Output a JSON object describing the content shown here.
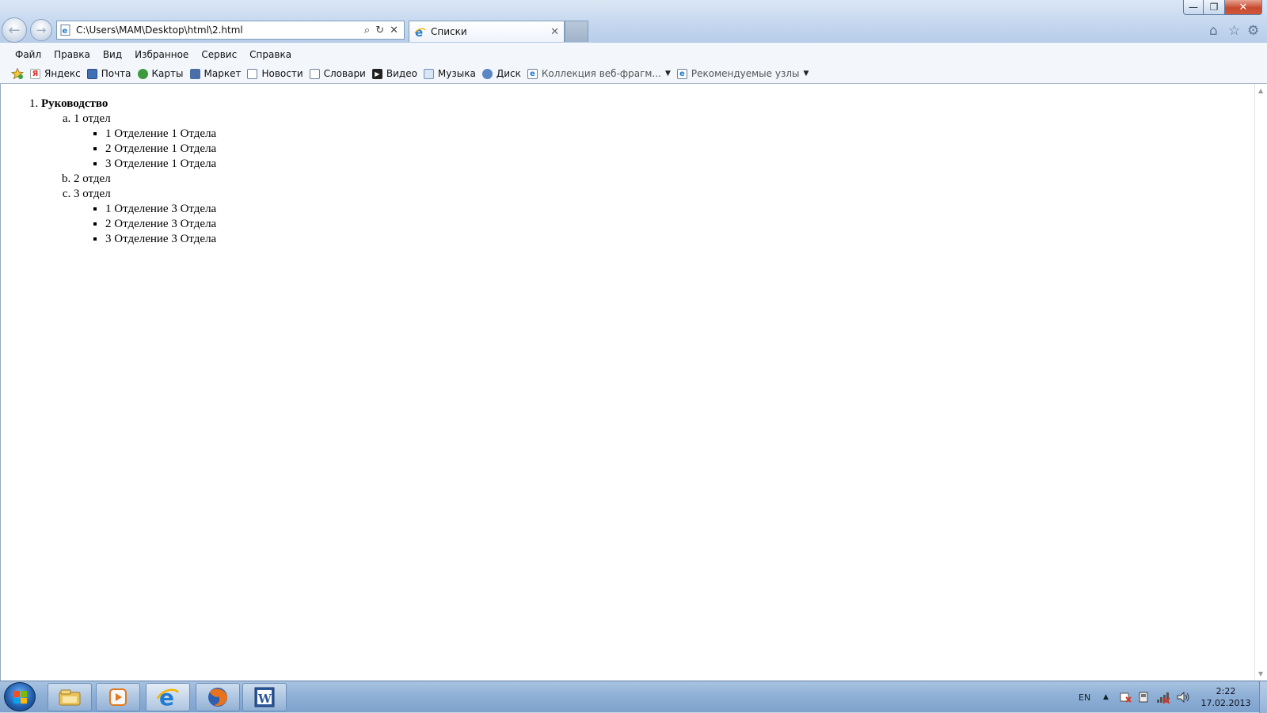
{
  "window": {
    "minimize_glyph": "—",
    "maximize_glyph": "❐",
    "close_glyph": "✕"
  },
  "nav": {
    "back_glyph": "←",
    "forward_glyph": "→"
  },
  "address": {
    "url": "C:\\Users\\MAM\\Desktop\\html\\2.html",
    "search_glyph": "⌕",
    "refresh_glyph": "↻",
    "stop_glyph": "✕"
  },
  "tab": {
    "title": "Списки",
    "close_glyph": "✕"
  },
  "right_icons": {
    "home_glyph": "⌂",
    "favorites_glyph": "☆",
    "tools_glyph": "⚙"
  },
  "menu": [
    "Файл",
    "Правка",
    "Вид",
    "Избранное",
    "Сервис",
    "Справка"
  ],
  "favorites": [
    {
      "label": "Яндекс",
      "icon": "yandex-icon",
      "color": "#e22b2b"
    },
    {
      "label": "Почта",
      "icon": "mail-icon",
      "color": "#3f6fb4"
    },
    {
      "label": "Карты",
      "icon": "maps-icon",
      "color": "#3c9a3c"
    },
    {
      "label": "Маркет",
      "icon": "market-icon",
      "color": "#4a6fa8"
    },
    {
      "label": "Новости",
      "icon": "news-icon",
      "color": "#6d7f99"
    },
    {
      "label": "Словари",
      "icon": "dictionary-icon",
      "color": "#6d7f99"
    },
    {
      "label": "Видео",
      "icon": "video-icon",
      "color": "#222222"
    },
    {
      "label": "Музыка",
      "icon": "music-icon",
      "color": "#6d8fbf"
    },
    {
      "label": "Диск",
      "icon": "disk-icon",
      "color": "#5a86c4"
    },
    {
      "label": "Коллекция веб-фрагм...",
      "icon": "ie-page-icon",
      "color": "#1f7bd1"
    },
    {
      "label": "Рекомендуемые узлы",
      "icon": "ie-page-icon",
      "color": "#1f7bd1"
    }
  ],
  "content": {
    "root": "Руководство",
    "departments": [
      {
        "name": "1 отдел",
        "sections": [
          "1 Отделение 1 Отдела",
          "2 Отделение 1 Отдела",
          "3 Отделение 1 Отдела"
        ]
      },
      {
        "name": "2 отдел",
        "sections": []
      },
      {
        "name": "3 отдел",
        "sections": [
          "1 Отделение 3 Отдела",
          "2 Отделение 3 Отдела",
          "3 Отделение 3 Отдела"
        ]
      }
    ]
  },
  "taskbar": {
    "apps": [
      "file-explorer-icon",
      "media-player-icon",
      "internet-explorer-icon",
      "firefox-icon",
      "word-icon"
    ],
    "language": "EN",
    "time": "2:22",
    "date": "17.02.2013"
  },
  "colors": {
    "accent": "#1f7bd1",
    "page_bg": "#ffffff",
    "chrome_bg": "#c3d6ee"
  }
}
